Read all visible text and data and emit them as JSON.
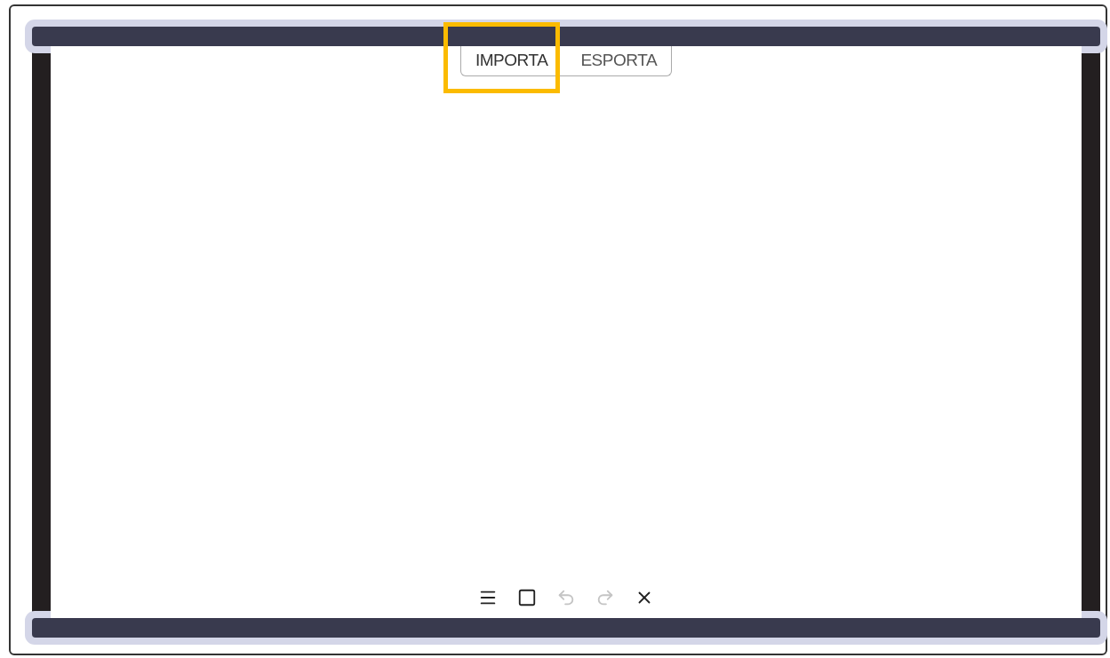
{
  "tabs": [
    {
      "label": "IMPORTA",
      "highlighted": true
    },
    {
      "label": "ESPORTA",
      "highlighted": false
    }
  ],
  "toolbar": [
    {
      "kind": "menu",
      "disabled": false
    },
    {
      "kind": "square",
      "disabled": false
    },
    {
      "kind": "undo",
      "disabled": true
    },
    {
      "kind": "redo",
      "disabled": true
    },
    {
      "kind": "close",
      "disabled": false
    }
  ]
}
